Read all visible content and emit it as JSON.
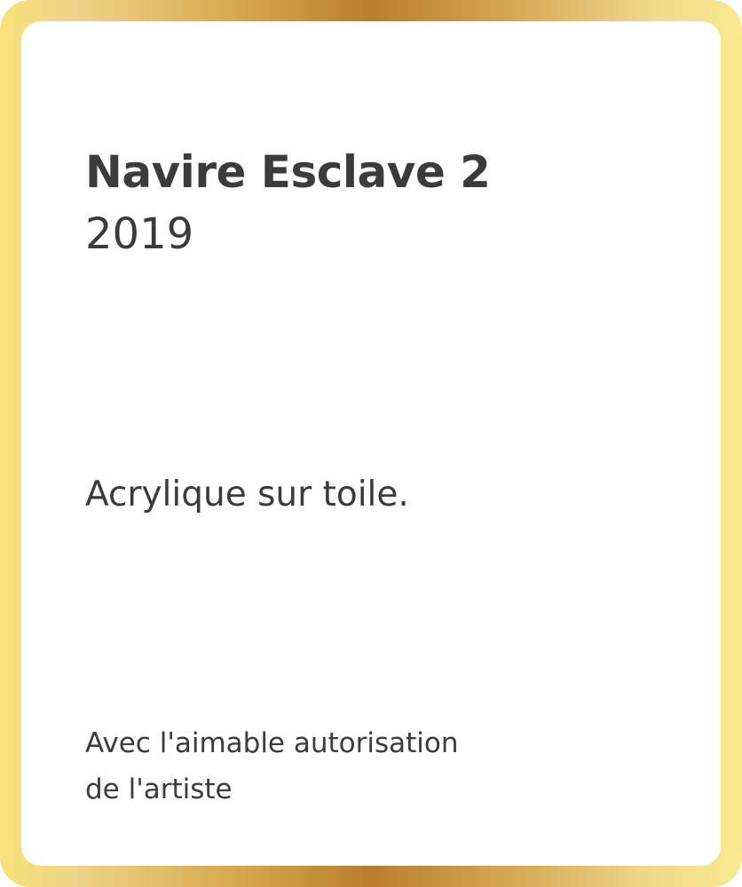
{
  "artwork": {
    "title": "Navire Esclave 2",
    "year": "2019",
    "medium": "Acrylique sur toile.",
    "credit_line_1": "Avec l'aimable autorisation",
    "credit_line_2": "de l'artiste"
  },
  "colors": {
    "frame_gold_dark": "#b97e2c",
    "frame_gold_light": "#f9ea8e",
    "text": "#3b3b3b",
    "background": "#ffffff"
  }
}
